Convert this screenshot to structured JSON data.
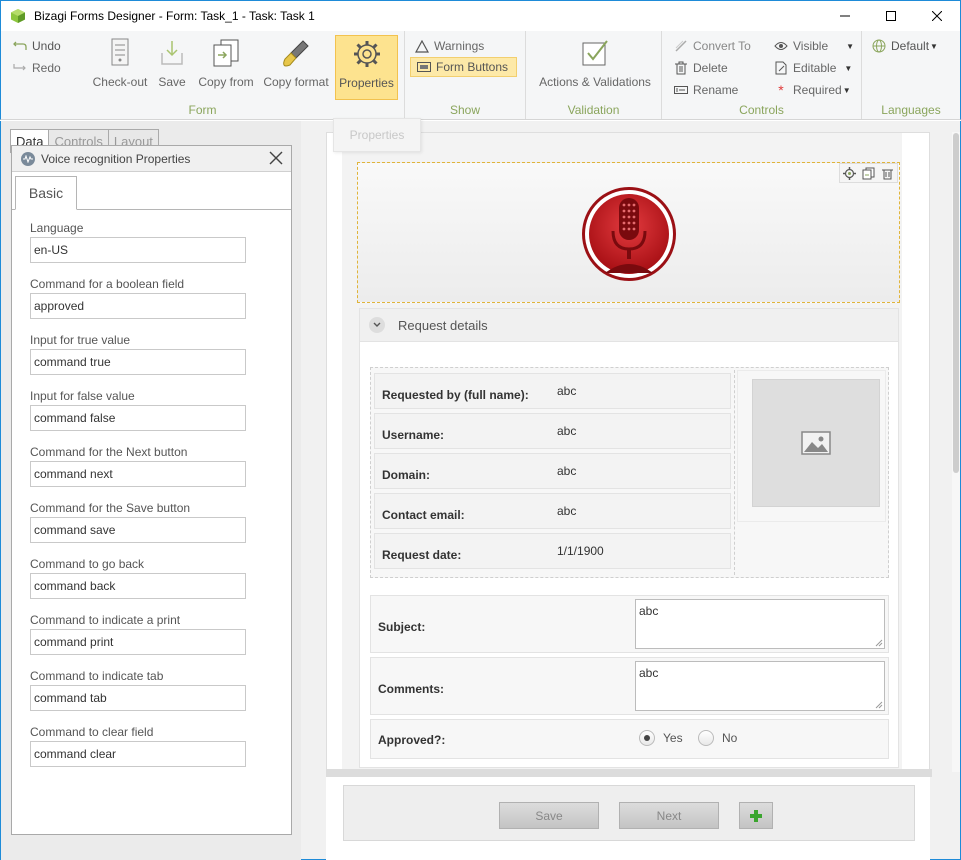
{
  "window": {
    "title": "Bizagi Forms Designer  - Form: Task_1 - Task:  Task 1"
  },
  "ribbon": {
    "undo": "Undo",
    "redo": "Redo",
    "form_group": {
      "label": "Form",
      "checkout": "Check-out",
      "save": "Save",
      "copy_from": "Copy from",
      "copy_format": "Copy format",
      "properties": "Properties"
    },
    "show_group": {
      "label": "Show",
      "warnings": "Warnings",
      "form_buttons": "Form Buttons"
    },
    "validation_group": {
      "label": "Validation",
      "actions_validations": "Actions & Validations"
    },
    "controls_group": {
      "label": "Controls",
      "convert_to": "Convert To",
      "delete": "Delete",
      "rename": "Rename",
      "visible": "Visible",
      "editable": "Editable",
      "required": "Required"
    },
    "languages_group": {
      "label": "Languages",
      "default": "Default"
    },
    "tooltip": "Properties"
  },
  "left_tabs": [
    "Data",
    "Controls",
    "Layout"
  ],
  "properties_panel": {
    "title": "Voice recognition Properties",
    "tab": "Basic",
    "fields": [
      {
        "label": "Language",
        "value": "en-US"
      },
      {
        "label": "Command for a boolean field",
        "value": "approved"
      },
      {
        "label": "Input for true value",
        "value": "command true"
      },
      {
        "label": "Input for false value",
        "value": "command false"
      },
      {
        "label": "Command for the Next button",
        "value": "command next"
      },
      {
        "label": "Command for the Save button",
        "value": "command save"
      },
      {
        "label": "Command to go back",
        "value": "command back"
      },
      {
        "label": "Command to indicate a print",
        "value": "command print"
      },
      {
        "label": "Command to indicate tab",
        "value": "command tab"
      },
      {
        "label": "Command to clear field",
        "value": "command clear"
      }
    ]
  },
  "form": {
    "section_title": "Request details",
    "grid_rows": [
      {
        "label": "Requested by (full name):",
        "value": "abc"
      },
      {
        "label": "Username:",
        "value": "abc"
      },
      {
        "label": "Domain:",
        "value": "abc"
      },
      {
        "label": "Contact email:",
        "value": "abc"
      },
      {
        "label": "Request date:",
        "value": "1/1/1900"
      }
    ],
    "subject": {
      "label": "Subject:",
      "value": "abc"
    },
    "comments": {
      "label": "Comments:",
      "value": "abc"
    },
    "approved": {
      "label": "Approved?:",
      "yes": "Yes",
      "no": "No",
      "selected": "Yes"
    },
    "buttons": {
      "save": "Save",
      "next": "Next"
    }
  },
  "colors": {
    "accent_green": "#8aa55c",
    "window_border": "#1e8bd8",
    "active_highlight": "#fde38f",
    "mic_red": "#c8161d"
  }
}
